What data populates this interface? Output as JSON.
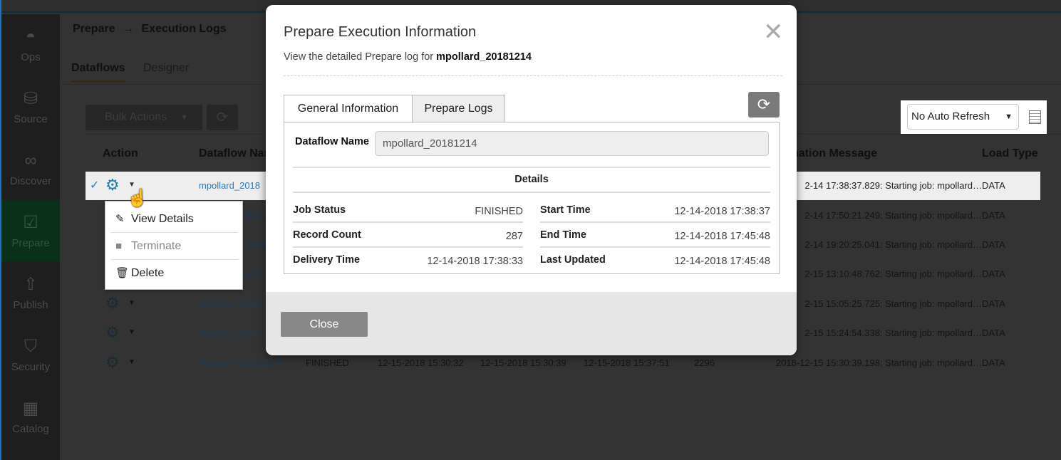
{
  "sidebar": {
    "items": [
      {
        "label": "Ops",
        "icon": "dashboard-gauge-icon"
      },
      {
        "label": "Source",
        "icon": "database-icon"
      },
      {
        "label": "Discover",
        "icon": "binoculars-icon"
      },
      {
        "label": "Prepare",
        "icon": "clipboard-check-icon",
        "active": true
      },
      {
        "label": "Publish",
        "icon": "rocket-icon"
      },
      {
        "label": "Security",
        "icon": "shield-icon"
      },
      {
        "label": "Catalog",
        "icon": "grid-icon"
      }
    ]
  },
  "breadcrumb": {
    "parent": "Prepare",
    "separator": "→",
    "current": "Execution Logs"
  },
  "tabs": {
    "dataflows": "Dataflows",
    "designer": "Designer"
  },
  "toolbar": {
    "bulk_actions": "Bulk Actions",
    "auto_refresh": "No Auto Refresh"
  },
  "table": {
    "headers": {
      "action": "Action",
      "dataflow_name": "Dataflow Nan",
      "message": "nation Message",
      "load_type": "Load Type"
    },
    "rows": [
      {
        "name": "mpollard_2018",
        "message": "2-14 17:38:37.829: Starting job: mpollard…",
        "load_type": "DATA",
        "selected": true
      },
      {
        "name": "2018",
        "message": "2-14 17:50:21.249: Starting job: mpollard…",
        "load_type": "DATA"
      },
      {
        "name": "2018",
        "message": "2-14 19:20:25.041: Starting job: mpollard…",
        "load_type": "DATA"
      },
      {
        "name": "2018",
        "message": "2-15 13:10:48.762: Starting job: mpollard…",
        "load_type": "DATA"
      },
      {
        "name": "mpollard_2018",
        "message": "2-15 15:05:25.725: Starting job: mpollard…",
        "load_type": "DATA"
      },
      {
        "name": "mpollard_2018",
        "message": "2-15 15:24:54.338: Starting job: mpollard…",
        "load_type": "DATA"
      },
      {
        "name": "mpollard_20181214",
        "status": "FINISHED",
        "delivery": "12-15-2018 15:30:32",
        "start": "12-15-2018 15:30:39",
        "end": "12-15-2018 15:37:51",
        "count": "2296",
        "message": "2018-12-15 15:30:39.198: Starting job: mpollard…",
        "load_type": "DATA"
      }
    ]
  },
  "context_menu": {
    "items": [
      {
        "label": "View Details",
        "icon": "pencil-icon"
      },
      {
        "label": "Terminate",
        "icon": "stop-square-icon",
        "disabled": true
      },
      {
        "label": "Delete",
        "icon": "trash-icon"
      }
    ]
  },
  "modal": {
    "title": "Prepare Execution Information",
    "subtitle_prefix": "View the detailed Prepare log for",
    "subtitle_name": "mpollard_20181214",
    "tabs": [
      "General Information",
      "Prepare Logs"
    ],
    "dataflow_name_label": "Dataflow Name",
    "dataflow_name_value": "mpollard_20181214",
    "details_heading": "Details",
    "fields": {
      "job_status": {
        "label": "Job Status",
        "value": "FINISHED"
      },
      "record_count": {
        "label": "Record Count",
        "value": "287"
      },
      "delivery_time": {
        "label": "Delivery Time",
        "value": "12-14-2018 17:38:33"
      },
      "start_time": {
        "label": "Start Time",
        "value": "12-14-2018 17:38:37"
      },
      "end_time": {
        "label": "End Time",
        "value": "12-14-2018 17:45:48"
      },
      "last_updated": {
        "label": "Last Updated",
        "value": "12-14-2018 17:45:48"
      }
    },
    "close_label": "Close"
  }
}
